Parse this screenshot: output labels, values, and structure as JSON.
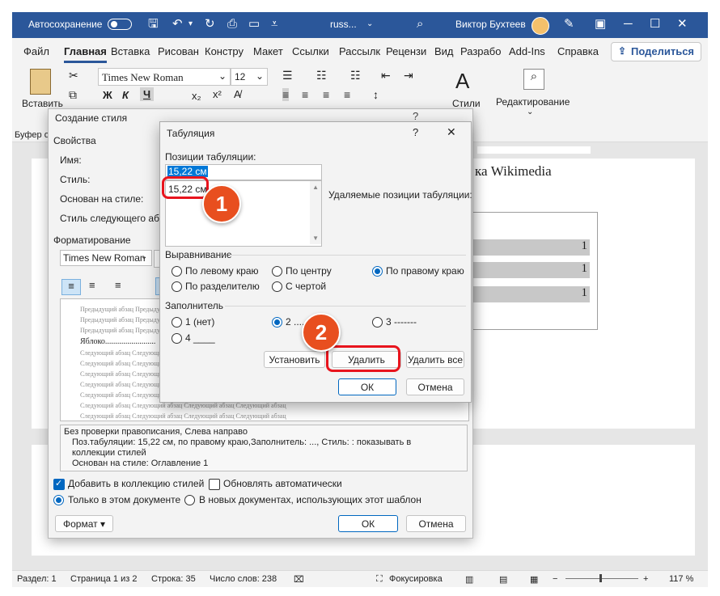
{
  "titlebar": {
    "autosave": "Автосохранение",
    "filename": "russ...",
    "user": "Виктор Бухтеев"
  },
  "menu": {
    "tabs": [
      "Файл",
      "Главная",
      "Вставка",
      "Рисован",
      "Констру",
      "Макет",
      "Ссылки",
      "Рассылк",
      "Рецензи",
      "Вид",
      "Разрабо",
      "Add-Ins",
      "Справка"
    ],
    "share": "Поделиться"
  },
  "ribbon": {
    "paste": "Вставить",
    "font": "Times New Roman",
    "size": "12",
    "bold": "Ж",
    "italic": "К",
    "underline": "Ч",
    "styles": "Стили",
    "editing": "Редактирование",
    "clipboard": "Буфер о"
  },
  "document": {
    "heading_fragment": "ка Wikimedia",
    "toc_number": "1"
  },
  "statusbar": {
    "section": "Раздел: 1",
    "page": "Страница 1 из 2",
    "line": "Строка: 35",
    "words": "Число слов: 238",
    "focus": "Фокусировка",
    "zoom": "117 %"
  },
  "style_dialog": {
    "title": "Создание стиля",
    "properties": "Свойства",
    "name_label": "Имя:",
    "style_label": "Стиль:",
    "based_on_label": "Основан на стиле:",
    "next_style_label": "Стиль следующего абзаца:",
    "formatting": "Форматирование",
    "font": "Times New Roman",
    "preview_prev": "Предыдущий абзац Предыдущий абзац Предыдущий абзац",
    "preview_sample": "Яблоко.........................",
    "preview_next": "Следующий абзац Следующий абзац Следующий абзац Следующий абзац",
    "description": [
      "Без проверки правописания, Слева направо",
      "Поз.табуляции:  15,22 см, по правому краю,Заполнитель: ..., Стиль: : показывать в коллекции стилей",
      "Основан на стиле: Оглавление 1"
    ],
    "add_to_gallery": "Добавить в коллекцию стилей",
    "auto_update": "Обновлять автоматически",
    "only_this_doc": "Только в этом документе",
    "new_docs": "В новых документах, использующих этот шаблон",
    "format_btn": "Формат",
    "ok": "ОК",
    "cancel": "Отмена"
  },
  "tabs_dialog": {
    "title": "Табуляция",
    "help": "?",
    "positions_label": "Позиции табуляции:",
    "position_value": "15,22 см",
    "list_item": "15,22 см",
    "clear_label": "Удаляемые позиции табуляции:",
    "alignment_label": "Выравнивание",
    "align_left": "По левому краю",
    "align_center": "По центру",
    "align_right": "По правому краю",
    "align_decimal": "По разделителю",
    "align_bar": "С чертой",
    "leader_label": "Заполнитель",
    "leader_1": "1 (нет)",
    "leader_2": "2 .......",
    "leader_3": "3 -------",
    "leader_4": "4 ____",
    "set_btn": "Установить",
    "clear_btn": "Удалить",
    "clear_all_btn": "Удалить все",
    "ok": "ОК",
    "cancel": "Отмена"
  },
  "annotations": {
    "badge_1": "1",
    "badge_2": "2"
  }
}
